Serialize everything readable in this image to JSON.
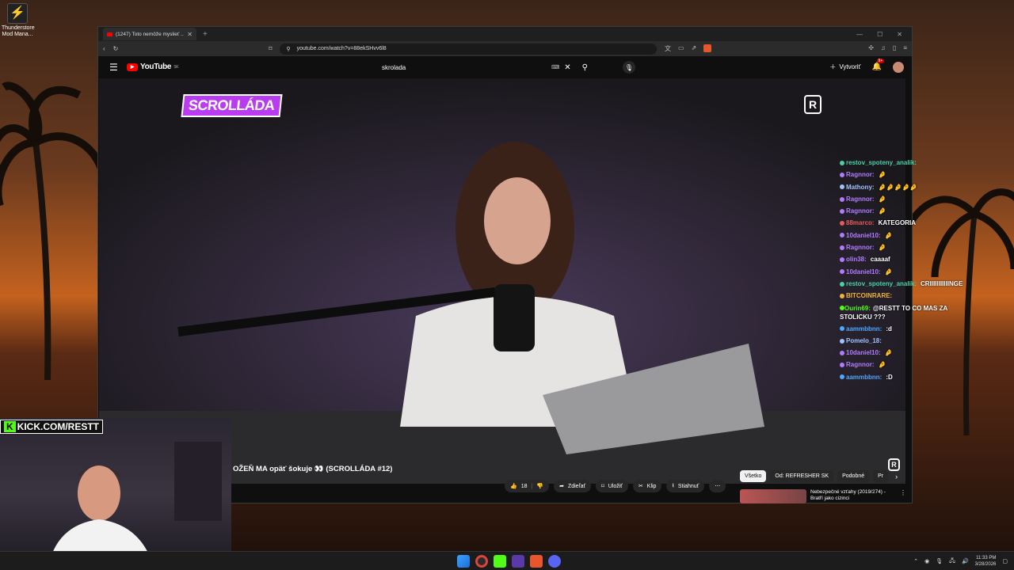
{
  "desktop": {
    "icon_label": "Thunderstore Mod Mana..."
  },
  "browser": {
    "tab_title": "(1247) Toto nemôže myslieť ...",
    "url": "youtube.com/watch?v=88ekSHvv6l8"
  },
  "youtube": {
    "logo_text": "YouTube",
    "logo_region": "SK",
    "search_value": "skrolada",
    "create_label": "Vytvoriť",
    "notification_count": "9+",
    "video_title": "OŽEŇ MA opäť šokuje 👀 (SCROLLÁDA #12)",
    "overlay_logo": "SCROLLÁDA",
    "watermark": "R",
    "likes": "18",
    "actions": {
      "share": "Zdieľať",
      "save": "Uložiť",
      "clip": "Klip",
      "download": "Stiahnuť"
    },
    "chips": [
      "Všetko",
      "Od: REFRESHER SK",
      "Podobné",
      "Pr"
    ],
    "recommendation_title": "Nebezpečné vzťahy (2019/274) - Bratří jako cizinci"
  },
  "chat": [
    {
      "user": "restov_spoteny_analik:",
      "msg": "",
      "color": "#47d1a8"
    },
    {
      "user": "Ragnnor:",
      "msg": "🤌",
      "color": "#b07cff"
    },
    {
      "user": "Mathony:",
      "msg": "🤌🤌🤌🤌🤌",
      "color": "#9ec3ff"
    },
    {
      "user": "Ragnnor:",
      "msg": "🤌",
      "color": "#b07cff"
    },
    {
      "user": "Ragnnor:",
      "msg": "🤌",
      "color": "#b07cff"
    },
    {
      "user": "88marco:",
      "msg": "KATEGORIA",
      "color": "#e85a5a"
    },
    {
      "user": "10daniel10:",
      "msg": "🤌",
      "color": "#b07cff"
    },
    {
      "user": "Ragnnor:",
      "msg": "🤌",
      "color": "#b07cff"
    },
    {
      "user": "olin38:",
      "msg": "caaaaf",
      "color": "#b07cff"
    },
    {
      "user": "10daniel10:",
      "msg": "🤌",
      "color": "#b07cff"
    },
    {
      "user": "restov_spoteny_analik:",
      "msg": "CRIIIIIIIIIIINGE",
      "color": "#47d1a8"
    },
    {
      "user": "BITCOINRARE:",
      "msg": "",
      "color": "#f0b43c"
    },
    {
      "user": "Ourin69:",
      "msg": "@RESTT TO CO MAS ZA STOLICKU ???",
      "color": "#53fc18",
      "wrap": true
    },
    {
      "user": "aammbbnn:",
      "msg": ":d",
      "color": "#4fa8ff"
    },
    {
      "user": "Pomelo_18:",
      "msg": "",
      "color": "#9ec3ff"
    },
    {
      "user": "10daniel10:",
      "msg": "🤌",
      "color": "#b07cff"
    },
    {
      "user": "Ragnnor:",
      "msg": "🤌",
      "color": "#b07cff"
    },
    {
      "user": "aammbbnn:",
      "msg": ":D",
      "color": "#4fa8ff"
    }
  ],
  "stream": {
    "kick_prefix": "K",
    "kick_url": "KICK.COM/RESTT"
  },
  "taskbar": {
    "time": "11:33 PM",
    "date": "3/28/2026"
  }
}
